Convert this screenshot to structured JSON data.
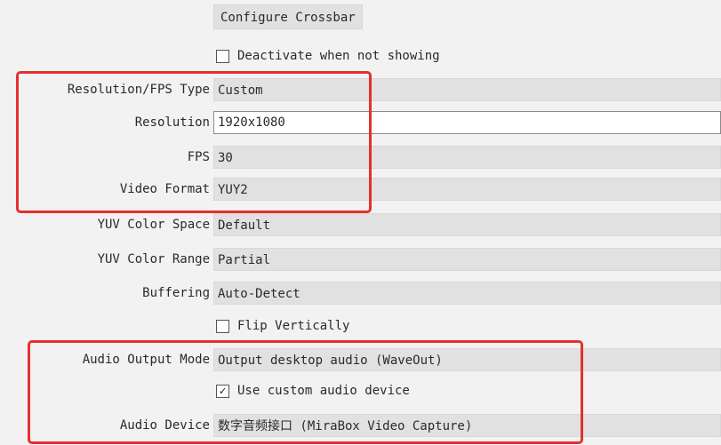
{
  "configure_crossbar": "Configure Crossbar",
  "deactivate": {
    "label": "Deactivate when not showing",
    "checked": false
  },
  "resolution_fps_type": {
    "label": "Resolution/FPS Type",
    "value": "Custom"
  },
  "resolution": {
    "label": "Resolution",
    "value": "1920x1080"
  },
  "fps": {
    "label": "FPS",
    "value": "30"
  },
  "video_format": {
    "label": "Video Format",
    "value": "YUY2"
  },
  "yuv_color_space": {
    "label": "YUV Color Space",
    "value": "Default"
  },
  "yuv_color_range": {
    "label": "YUV Color Range",
    "value": "Partial"
  },
  "buffering": {
    "label": "Buffering",
    "value": "Auto-Detect"
  },
  "flip_vertically": {
    "label": "Flip Vertically",
    "checked": false
  },
  "audio_output_mode": {
    "label": "Audio Output Mode",
    "value": "Output desktop audio (WaveOut)"
  },
  "use_custom_audio": {
    "label": "Use custom audio device",
    "checked": true,
    "check_glyph": "✓"
  },
  "audio_device": {
    "label": "Audio Device",
    "value": "数字音频接口 (MiraBox Video Capture)"
  },
  "highlight_color": "#e5302d",
  "icons": {
    "checkbox": "checkbox-icon",
    "checkmark": "checkmark-icon"
  }
}
